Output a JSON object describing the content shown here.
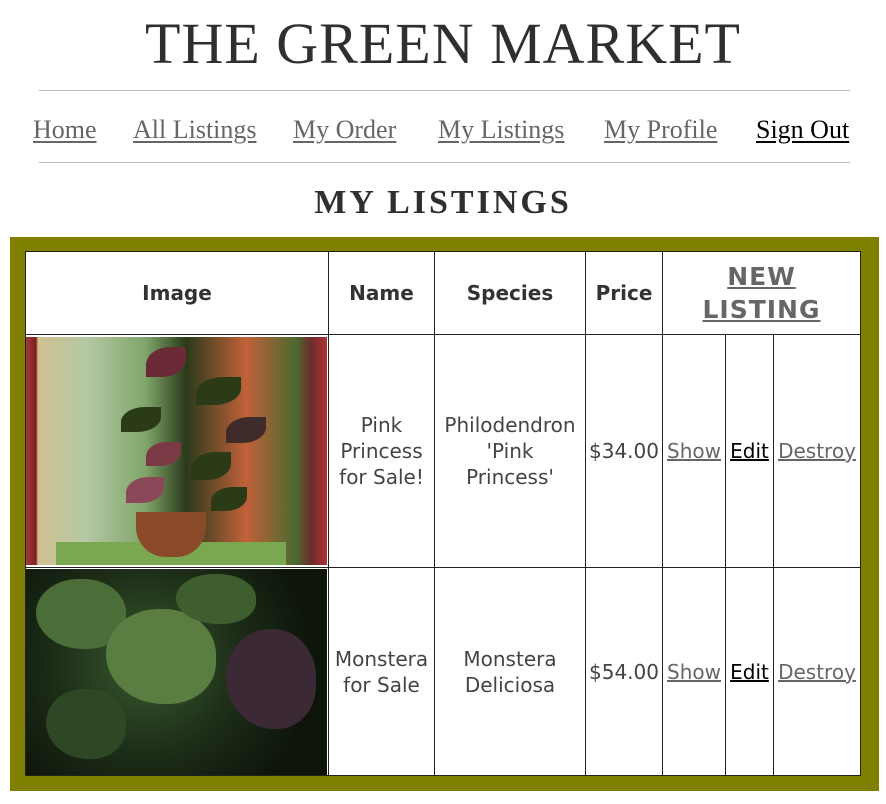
{
  "site": {
    "title": "THE GREEN MARKET"
  },
  "nav": {
    "home": "Home",
    "all_listings": "All Listings",
    "my_order": "My Order",
    "my_listings": "My Listings",
    "my_profile": "My Profile",
    "sign_out": "Sign Out"
  },
  "page": {
    "heading": "MY LISTINGS"
  },
  "table": {
    "headers": {
      "image": "Image",
      "name": "Name",
      "species": "Species",
      "price": "Price"
    },
    "new_listing_line1": "NEW",
    "new_listing_line2": "LISTING",
    "rows": [
      {
        "name_lines": [
          "Pink",
          "Princess",
          "for Sale!"
        ],
        "species_lines": [
          "Philodendron",
          "'Pink",
          "Princess'"
        ],
        "price": "$34.00",
        "show": "Show",
        "edit": "Edit",
        "destroy": "Destroy"
      },
      {
        "name_lines": [
          "Monstera",
          "for Sale"
        ],
        "species_lines": [
          "Monstera",
          "Deliciosa"
        ],
        "price": "$54.00",
        "show": "Show",
        "edit": "Edit",
        "destroy": "Destroy"
      }
    ]
  },
  "colors": {
    "panel": "#808000",
    "link": "#666666",
    "edit_link": "#000000"
  }
}
